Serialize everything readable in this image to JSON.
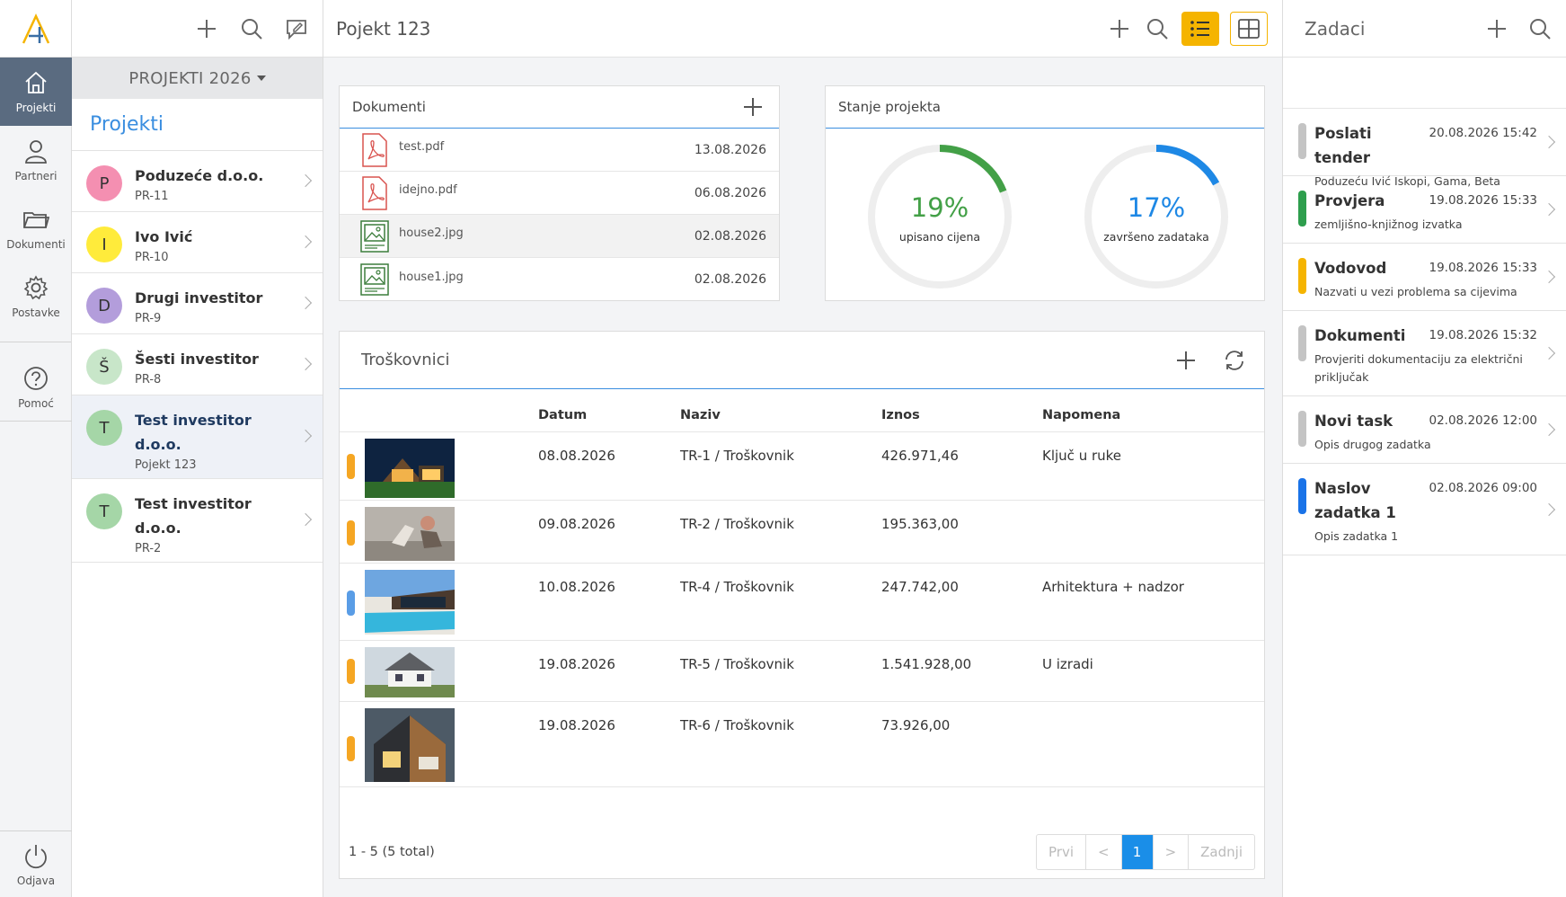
{
  "nav": {
    "items": [
      {
        "label": "Projekti",
        "icon": "home-icon"
      },
      {
        "label": "Partneri",
        "icon": "user-icon"
      },
      {
        "label": "Dokumenti",
        "icon": "folder-icon"
      },
      {
        "label": "Postavke",
        "icon": "gear-icon"
      }
    ],
    "help": "Pomoć",
    "logout": "Odjava"
  },
  "projects": {
    "year": "PROJEKTI 2026",
    "heading": "Projekti",
    "items": [
      {
        "initial": "P",
        "color": "#f48fb1",
        "name": "Poduzeće d.o.o.",
        "code": "PR-11"
      },
      {
        "initial": "I",
        "color": "#ffeb3b",
        "name": "Ivo Ivić",
        "code": "PR-10"
      },
      {
        "initial": "D",
        "color": "#b39ddb",
        "name": "Drugi investitor",
        "code": "PR-9"
      },
      {
        "initial": "Š",
        "color": "#c8e6c9",
        "name": "Šesti investitor",
        "code": "PR-8"
      },
      {
        "initial": "T",
        "color": "#a5d6a7",
        "name": "Test investitor d.o.o.",
        "code": "Pojekt 123"
      },
      {
        "initial": "T",
        "color": "#a5d6a7",
        "name": "Test investitor d.o.o.",
        "code": "PR-2"
      }
    ]
  },
  "main": {
    "title": "Pojekt 123",
    "documents": {
      "title": "Dokumenti",
      "items": [
        {
          "name": "test.pdf",
          "date": "13.08.2026",
          "type": "pdf"
        },
        {
          "name": "idejno.pdf",
          "date": "06.08.2026",
          "type": "pdf"
        },
        {
          "name": "house2.jpg",
          "date": "02.08.2026",
          "type": "image"
        },
        {
          "name": "house1.jpg",
          "date": "02.08.2026",
          "type": "image"
        }
      ]
    },
    "status": {
      "title": "Stanje projekta",
      "gauges": [
        {
          "value": "19%",
          "fraction": 0.19,
          "label": "upisano cijena",
          "color": "#43a047"
        },
        {
          "value": "17%",
          "fraction": 0.17,
          "label": "završeno zadataka",
          "color": "#1e88e5"
        }
      ]
    },
    "costs": {
      "title": "Troškovnici",
      "columns": {
        "date": "Datum",
        "name": "Naziv",
        "amount": "Iznos",
        "note": "Napomena"
      },
      "rows": [
        {
          "date": "08.08.2026",
          "name": "TR-1 / Troškovnik",
          "amount": "426.971,46",
          "note": "Ključ u ruke",
          "color": "#f5a623"
        },
        {
          "date": "09.08.2026",
          "name": "TR-2 / Troškovnik",
          "amount": "195.363,00",
          "note": "",
          "color": "#f5a623"
        },
        {
          "date": "10.08.2026",
          "name": "TR-4 / Troškovnik",
          "amount": "247.742,00",
          "note": "Arhitektura + nadzor",
          "color": "#5a9de6"
        },
        {
          "date": "19.08.2026",
          "name": "TR-5 / Troškovnik",
          "amount": "1.541.928,00",
          "note": "U izradi",
          "color": "#f5a623"
        },
        {
          "date": "19.08.2026",
          "name": "TR-6 / Troškovnik",
          "amount": "73.926,00",
          "note": "",
          "color": "#f5a623"
        }
      ],
      "count": "1 - 5 (5 total)",
      "pager": {
        "first": "Prvi",
        "prev": "<",
        "current": "1",
        "next": ">",
        "last": "Zadnji"
      }
    }
  },
  "tasks": {
    "title": "Zadaci",
    "items": [
      {
        "title": "Poslati tender",
        "date": "20.08.2026 15:42",
        "desc": "Poduzeću Ivić Iskopi, Gama, Beta",
        "color": "#c4c4c4"
      },
      {
        "title": "Provjera",
        "date": "19.08.2026 15:33",
        "desc": "zemljišno-knjižnog izvatka",
        "color": "#2e9e4d"
      },
      {
        "title": "Vodovod",
        "date": "19.08.2026 15:33",
        "desc": "Nazvati u vezi problema sa cijevima",
        "color": "#f5b400"
      },
      {
        "title": "Dokumenti",
        "date": "19.08.2026 15:32",
        "desc": "Provjeriti dokumentaciju za električni priključak",
        "color": "#c4c4c4"
      },
      {
        "title": "Novi task",
        "date": "02.08.2026 12:00",
        "desc": "Opis drugog zadatka",
        "color": "#c4c4c4"
      },
      {
        "title": "Naslov zadatka 1",
        "date": "02.08.2026 09:00",
        "desc": "Opis zadatka 1",
        "color": "#1a73e8"
      }
    ]
  }
}
